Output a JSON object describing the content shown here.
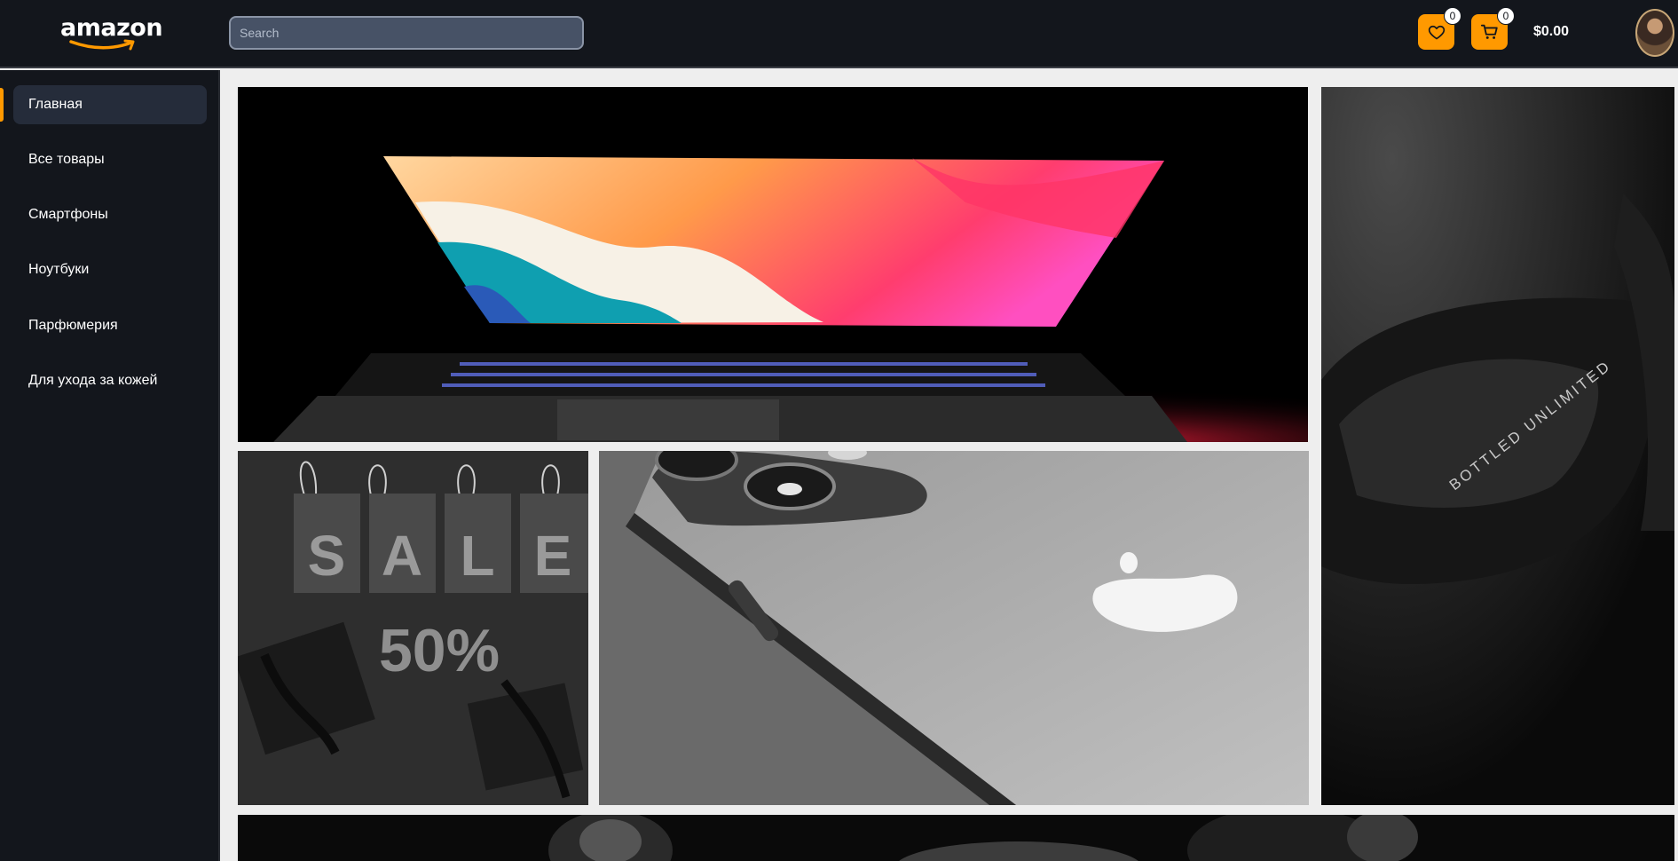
{
  "header": {
    "logo_text": "amazon",
    "search_placeholder": "Search",
    "favorites_count": "0",
    "cart_count": "0",
    "cart_total": "$0.00"
  },
  "sidebar": {
    "items": [
      {
        "label": "Главная",
        "active": true
      },
      {
        "label": "Все товары"
      },
      {
        "label": "Смартфоны"
      },
      {
        "label": "Ноутбуки"
      },
      {
        "label": "Парфюмерия"
      },
      {
        "label": "Для ухода за кожей"
      }
    ]
  },
  "banners": {
    "sale_letters": [
      "S",
      "A",
      "L",
      "E"
    ],
    "sale_text": "50%",
    "bottle_text": "BOTTLED UNLIMITED"
  },
  "colors": {
    "accent": "#ff9900",
    "header_bg": "#13161c",
    "active_item_bg": "#252c3a"
  }
}
